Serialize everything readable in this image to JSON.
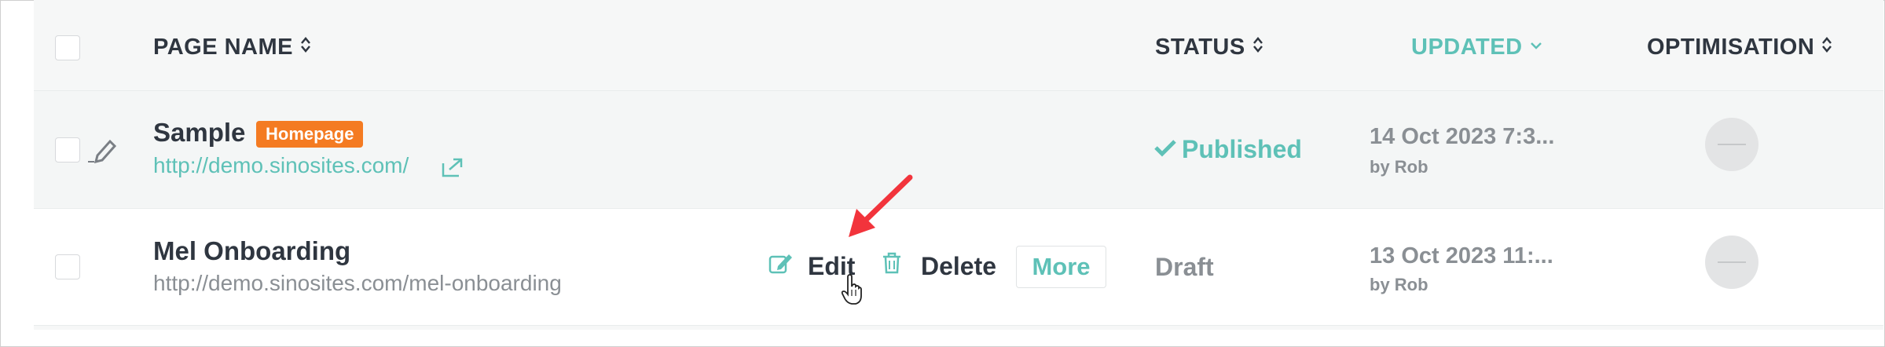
{
  "headers": {
    "page_name": "PAGE NAME",
    "status": "STATUS",
    "updated": "UPDATED",
    "optimisation": "OPTIMISATION"
  },
  "rows": [
    {
      "name": "Sample",
      "badge": "Homepage",
      "url": "http://demo.sinosites.com/",
      "status": "Published",
      "updated": "14 Oct 2023 7:3...",
      "by": "by Rob"
    },
    {
      "name": "Mel Onboarding",
      "url": "http://demo.sinosites.com/mel-onboarding",
      "status": "Draft",
      "updated": "13 Oct 2023 11:...",
      "by": "by Rob",
      "actions": {
        "edit": "Edit",
        "delete": "Delete",
        "more": "More"
      }
    }
  ],
  "colors": {
    "accent": "#5ec1b7",
    "badge": "#f47b22",
    "annotation_arrow": "#f2343c"
  }
}
